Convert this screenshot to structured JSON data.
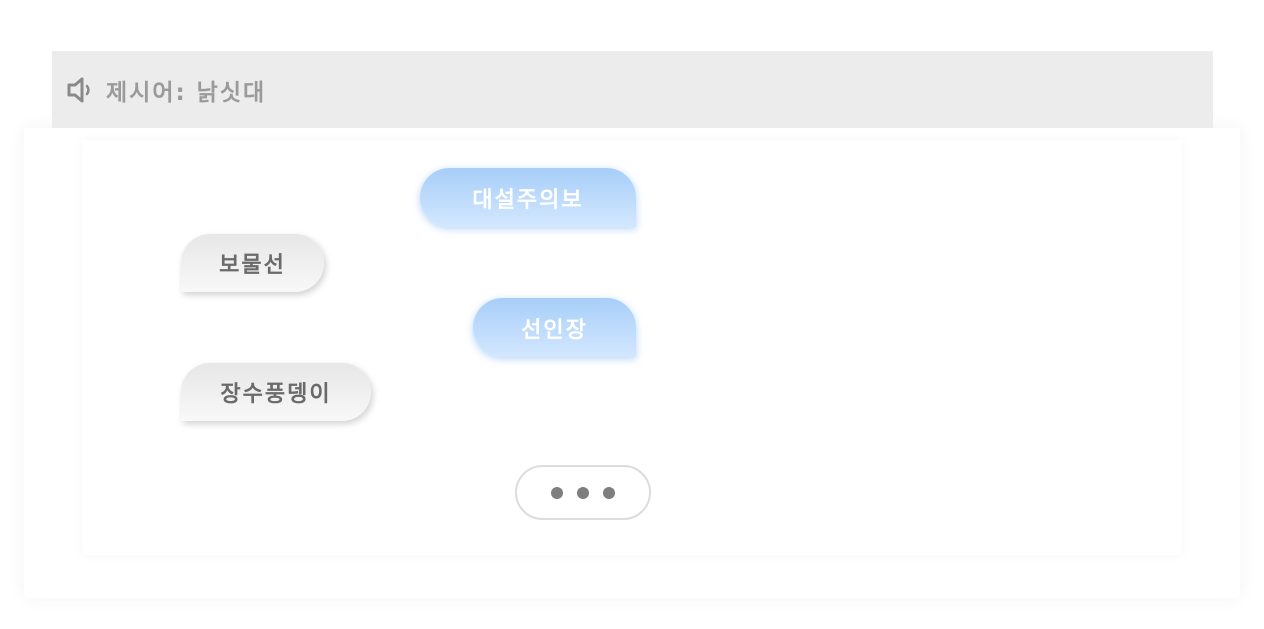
{
  "prompt": {
    "icon": "speaker-icon",
    "text": "제시어: 낡싯대"
  },
  "messages": [
    {
      "side": "right",
      "style": "blue",
      "text": "대설주의보"
    },
    {
      "side": "left",
      "style": "gray",
      "text": "보물선"
    },
    {
      "side": "right",
      "style": "blue",
      "text": "선인장"
    },
    {
      "side": "left",
      "style": "gray",
      "text": "장수풍뎅이"
    }
  ],
  "typing_indicator": {
    "dots": 3
  },
  "colors": {
    "prompt_bar": "#ececec",
    "prompt_text": "#9a9a9a",
    "blue_bubble_top": "#a7cef8",
    "blue_bubble_bottom": "#d3e7ff",
    "gray_bubble": "#ececec",
    "gray_text": "#6a6a6a",
    "dot": "#7e7e7e"
  }
}
